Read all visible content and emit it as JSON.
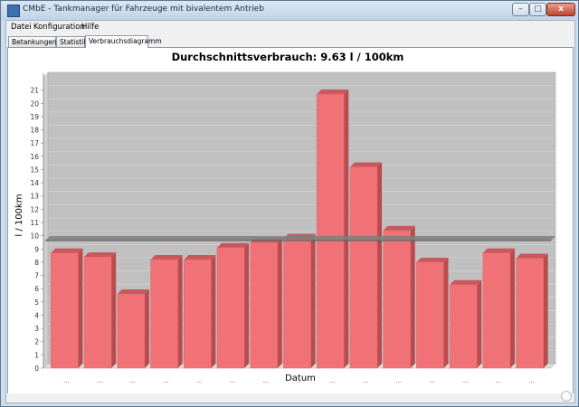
{
  "window": {
    "title": "CMbE - Tankmanager für Fahrzeuge mit bivalentem Antrieb",
    "minimize_glyph": "–",
    "maximize_glyph": "□",
    "close_glyph": "x"
  },
  "menu": [
    {
      "label": "Datei"
    },
    {
      "label": "Konfiguration"
    },
    {
      "label": "Hilfe"
    }
  ],
  "tabs": [
    {
      "label": "Betankungen",
      "active": false
    },
    {
      "label": "Statistik",
      "active": false
    },
    {
      "label": "Verbrauchsdiagramm",
      "active": true
    }
  ],
  "chart_data": {
    "type": "bar",
    "title": "Durchschnittsverbrauch: 9.63  l / 100km",
    "xlabel": "Datum",
    "ylabel": "l / 100km",
    "ylim": [
      0,
      22
    ],
    "yticks": [
      0,
      1,
      2,
      3,
      4,
      5,
      6,
      7,
      8,
      9,
      10,
      11,
      12,
      13,
      14,
      15,
      16,
      17,
      18,
      19,
      20,
      21
    ],
    "categories": [
      "...",
      "...",
      "...",
      "...",
      "...",
      "...",
      "...",
      "...",
      "...",
      "...",
      "...",
      "...",
      "...",
      "...",
      "..."
    ],
    "values": [
      8.7,
      8.4,
      5.6,
      8.2,
      8.2,
      9.1,
      9.5,
      9.8,
      20.7,
      15.2,
      10.4,
      8.0,
      6.3,
      8.7,
      8.3
    ],
    "average_line": 9.63,
    "bar_color": "#f07276",
    "plot_background": "#c0c0c0",
    "average_line_color": "#7f7f7f",
    "grid": true
  }
}
